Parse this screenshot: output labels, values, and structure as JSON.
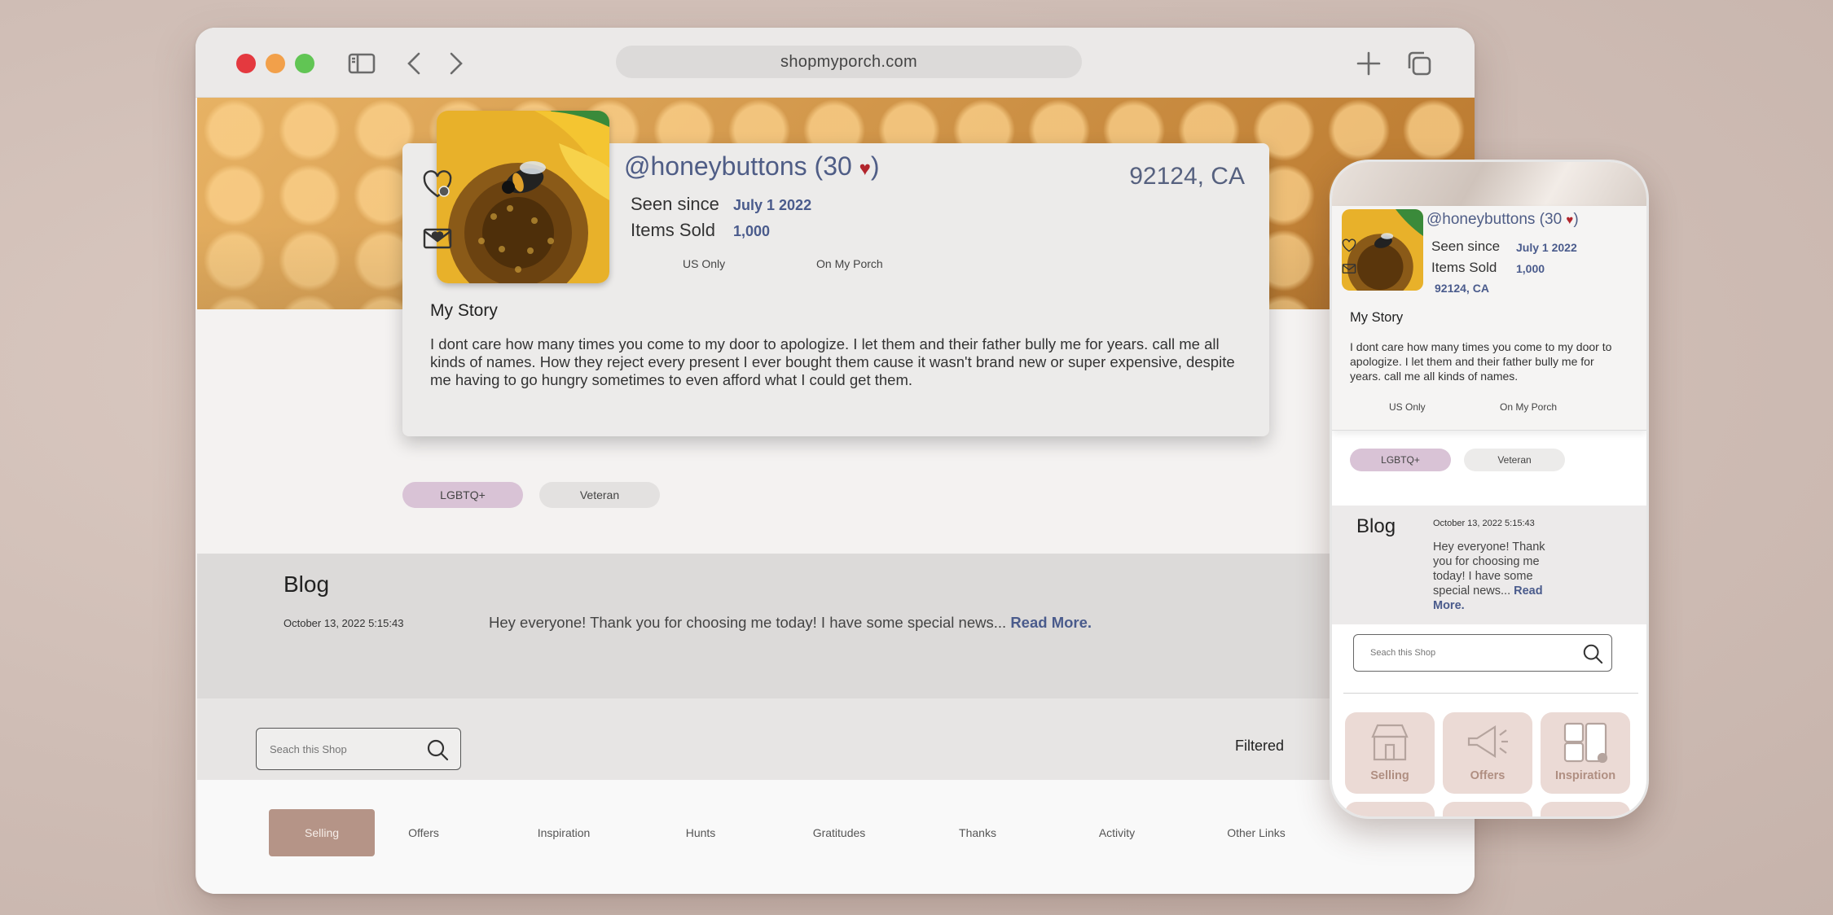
{
  "browser": {
    "url": "shopmyporch.com"
  },
  "profile": {
    "handle": "@honeybuttons",
    "likes": "30",
    "location": "92124, CA",
    "seen_since_label": "Seen since",
    "seen_since_value": "July 1 2022",
    "items_sold_label": "Items Sold",
    "items_sold_value": "1,000",
    "shipping": "US Only",
    "pickup": "On My Porch",
    "story_title": "My Story",
    "story_text": "I dont care how many times you come to my door to apologize. I let them and their father bully me for years. call me all kinds of names. How they reject every present I ever bought them cause it wasn't brand new or super expensive, despite me having to go hungry sometimes to even afford what I could get them.",
    "tags": [
      "LGBTQ+",
      "Veteran"
    ]
  },
  "blog": {
    "title": "Blog",
    "date": "October 13, 2022 5:15:43",
    "excerpt": "Hey everyone! Thank you for choosing me today! I have some special news...",
    "read_more": "Read More."
  },
  "search": {
    "placeholder": "Seach this Shop",
    "filtered_label": "Filtered"
  },
  "tabs": [
    "Selling",
    "Offers",
    "Inspiration",
    "Hunts",
    "Gratitudes",
    "Thanks",
    "Activity",
    "Other Links"
  ],
  "active_tab": "Selling",
  "mobile": {
    "story_text": "I dont care how many times you come to my door to apologize. I let them and their father bully me for years. call me all kinds of names.",
    "blog_excerpt": "Hey everyone! Thank you for choosing me today! I have some special news...",
    "tiles": [
      "Selling",
      "Offers",
      "Inspiration"
    ]
  },
  "colors": {
    "accent_text": "#4a5b8c",
    "active_tab": "#b59487",
    "heart": "#b2252c",
    "tag_pink": "#d9c3d6"
  }
}
